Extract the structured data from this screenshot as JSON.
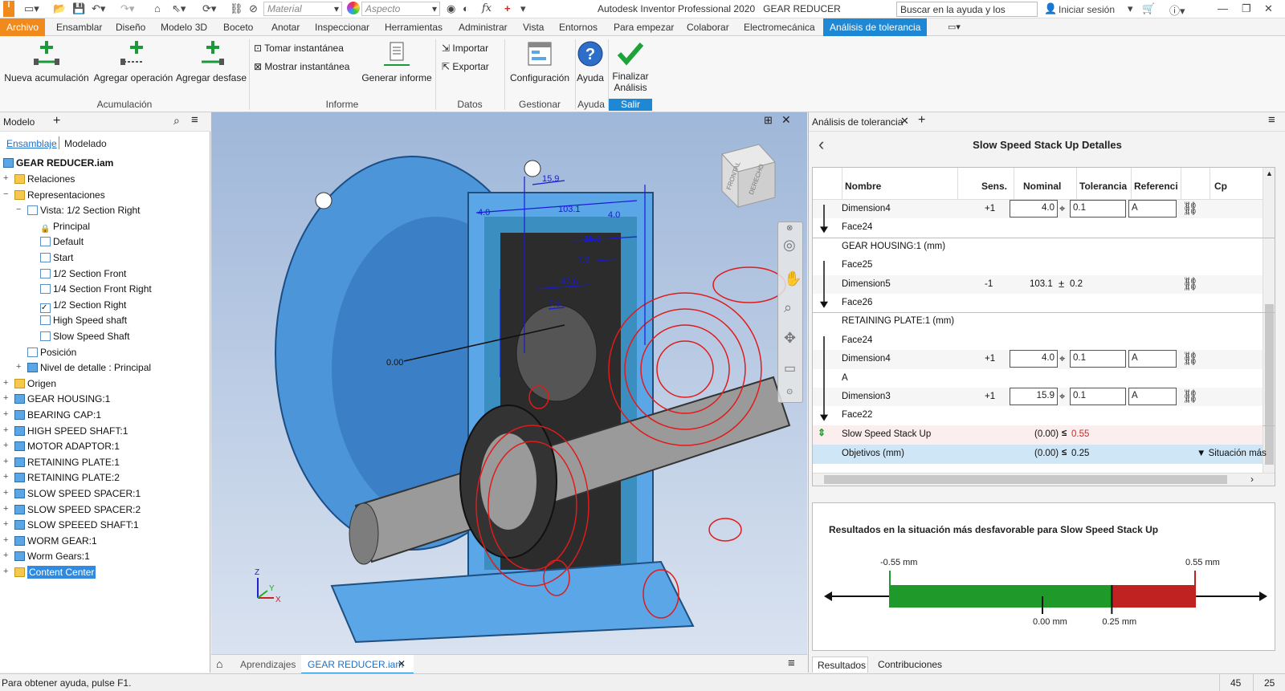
{
  "titlebar": {
    "material_placeholder": "Material",
    "appearance_placeholder": "Aspecto",
    "fx_label": "fx",
    "app_title": "Autodesk Inventor Professional 2020",
    "document_title": "GEAR REDUCER",
    "help_search": "Buscar en la ayuda y los comanc",
    "sign_in": "Iniciar sesión"
  },
  "tabs": [
    "Archivo",
    "Ensamblar",
    "Diseño",
    "Modelo 3D",
    "Boceto",
    "Anotar",
    "Inspeccionar",
    "Herramientas",
    "Administrar",
    "Vista",
    "Entornos",
    "Para empezar",
    "Colaborar",
    "Electromecánica",
    "Análisis de tolerancia"
  ],
  "ribbon": {
    "new_stack": "Nueva acumulación",
    "add_operation": "Agregar operación",
    "add_offset": "Agregar desfase",
    "take_snapshot": "Tomar instantánea",
    "show_snapshot": "Mostrar instantánea",
    "generate_report": "Generar informe",
    "import": "Importar",
    "export": "Exportar",
    "configuration": "Configuración",
    "help": "Ayuda",
    "finish_1": "Finalizar",
    "finish_2": "Análisis",
    "groups": {
      "stack": "Acumulación",
      "report": "Informe",
      "data": "Datos",
      "manage": "Gestionar",
      "help": "Ayuda",
      "exit": "Salir"
    }
  },
  "browser": {
    "title": "Modelo",
    "tab_assembly": "Ensamblaje",
    "tab_modeling": "Modelado",
    "root": "GEAR REDUCER.iam",
    "items": [
      {
        "label": "Relaciones",
        "indent": 0,
        "icon": "folder",
        "exp": "+"
      },
      {
        "label": "Representaciones",
        "indent": 0,
        "icon": "folder",
        "exp": "−"
      },
      {
        "label": "Vista: 1/2 Section Right",
        "indent": 1,
        "icon": "view",
        "exp": "−"
      },
      {
        "label": "Principal",
        "indent": 2,
        "icon": "lock",
        "exp": ""
      },
      {
        "label": "Default",
        "indent": 2,
        "icon": "view",
        "exp": ""
      },
      {
        "label": "Start",
        "indent": 2,
        "icon": "view",
        "exp": ""
      },
      {
        "label": "1/2 Section Front",
        "indent": 2,
        "icon": "view",
        "exp": ""
      },
      {
        "label": "1/4 Section Front Right",
        "indent": 2,
        "icon": "view",
        "exp": ""
      },
      {
        "label": "1/2 Section Right",
        "indent": 2,
        "icon": "check",
        "exp": ""
      },
      {
        "label": "High Speed shaft",
        "indent": 2,
        "icon": "view",
        "exp": ""
      },
      {
        "label": "Slow Speed Shaft",
        "indent": 2,
        "icon": "view",
        "exp": ""
      },
      {
        "label": "Posición",
        "indent": 1,
        "icon": "view",
        "exp": ""
      },
      {
        "label": "Nivel de detalle : Principal",
        "indent": 1,
        "icon": "part",
        "exp": "+"
      },
      {
        "label": "Origen",
        "indent": 0,
        "icon": "folder",
        "exp": "+"
      },
      {
        "label": "GEAR HOUSING:1",
        "indent": 0,
        "icon": "part",
        "exp": "+"
      },
      {
        "label": "BEARING CAP:1",
        "indent": 0,
        "icon": "part",
        "exp": "+"
      },
      {
        "label": "HIGH SPEED SHAFT:1",
        "indent": 0,
        "icon": "part",
        "exp": "+"
      },
      {
        "label": "MOTOR ADAPTOR:1",
        "indent": 0,
        "icon": "part",
        "exp": "+"
      },
      {
        "label": "RETAINING PLATE:1",
        "indent": 0,
        "icon": "part",
        "exp": "+"
      },
      {
        "label": "RETAINING PLATE:2",
        "indent": 0,
        "icon": "part",
        "exp": "+"
      },
      {
        "label": "SLOW SPEED SPACER:1",
        "indent": 0,
        "icon": "part",
        "exp": "+"
      },
      {
        "label": "SLOW SPEED SPACER:2",
        "indent": 0,
        "icon": "part",
        "exp": "+"
      },
      {
        "label": "SLOW SPEEED SHAFT:1",
        "indent": 0,
        "icon": "part",
        "exp": "+"
      },
      {
        "label": "WORM GEAR:1",
        "indent": 0,
        "icon": "part",
        "exp": "+"
      },
      {
        "label": "Worm Gears:1",
        "indent": 0,
        "icon": "pattern",
        "exp": "+"
      },
      {
        "label": "Content Center",
        "indent": 0,
        "icon": "folder",
        "exp": "+",
        "selected": true
      }
    ]
  },
  "viewport": {
    "dims": [
      "15.9",
      "4.0",
      "103.1",
      "4.0",
      "15.9",
      "7.9",
      "47.6",
      "7.9",
      "0.00"
    ],
    "viewcube_front": "FRONTAL",
    "viewcube_right": "DERECHO",
    "axis_x": "X",
    "axis_y": "Y",
    "axis_z": "Z"
  },
  "doc_tabs": {
    "learning": "Aprendizajes",
    "active": "GEAR REDUCER.iam"
  },
  "tolerance": {
    "panel_title": "Análisis de tolerancia",
    "details_title": "Slow Speed Stack Up Detalles",
    "headers": {
      "name": "Nombre",
      "sens": "Sens.",
      "nominal": "Nominal",
      "tolerance": "Tolerancia",
      "reference": "Referenci",
      "cp": "Cp"
    },
    "rows": [
      {
        "type": "dim",
        "name": "Dimension4",
        "sens": "+1",
        "nominal": "4.0",
        "tol": "0.1",
        "ref": "A",
        "boxed": true
      },
      {
        "type": "face",
        "name": "Face24"
      },
      {
        "type": "group",
        "name": "GEAR HOUSING:1 (mm)"
      },
      {
        "type": "face",
        "name": "Face25"
      },
      {
        "type": "dim",
        "name": "Dimension5",
        "sens": "-1",
        "nominal": "103.1",
        "tol": "0.2",
        "ref": "",
        "boxed": false
      },
      {
        "type": "face",
        "name": "Face26"
      },
      {
        "type": "group",
        "name": "RETAINING PLATE:1 (mm)"
      },
      {
        "type": "face",
        "name": "Face24"
      },
      {
        "type": "dim",
        "name": "Dimension4",
        "sens": "+1",
        "nominal": "4.0",
        "tol": "0.1",
        "ref": "A",
        "boxed": true
      },
      {
        "type": "face",
        "name": "A"
      },
      {
        "type": "dim",
        "name": "Dimension3",
        "sens": "+1",
        "nominal": "15.9",
        "tol": "0.1",
        "ref": "A",
        "boxed": true
      },
      {
        "type": "face",
        "name": "Face22"
      }
    ],
    "summary": {
      "name": "Slow Speed Stack Up",
      "value": "(0.00)",
      "limit": "0.55"
    },
    "goals": {
      "name": "Objetivos (mm)",
      "value": "(0.00)",
      "limit": "0.25",
      "situation": "Situación más"
    },
    "results_title": "Resultados en la situación más desfavorable para Slow Speed Stack Up",
    "min_label": "-0.55 mm",
    "max_label": "0.55 mm",
    "zero_label": "0.00 mm",
    "goal_label": "0.25 mm",
    "bottom_tabs": [
      "Resultados",
      "Contribuciones"
    ]
  },
  "status": {
    "help": "Para obtener ayuda, pulse F1.",
    "n1": "45",
    "n2": "25"
  },
  "colors": {
    "file_tab": "#f08a1c",
    "active_tab": "#1e88d4",
    "housing": "#4f9fe4",
    "dims": "#1a1ad6",
    "wire": "#e01b1b",
    "green": "#1f9a2a",
    "red": "#c02121"
  }
}
